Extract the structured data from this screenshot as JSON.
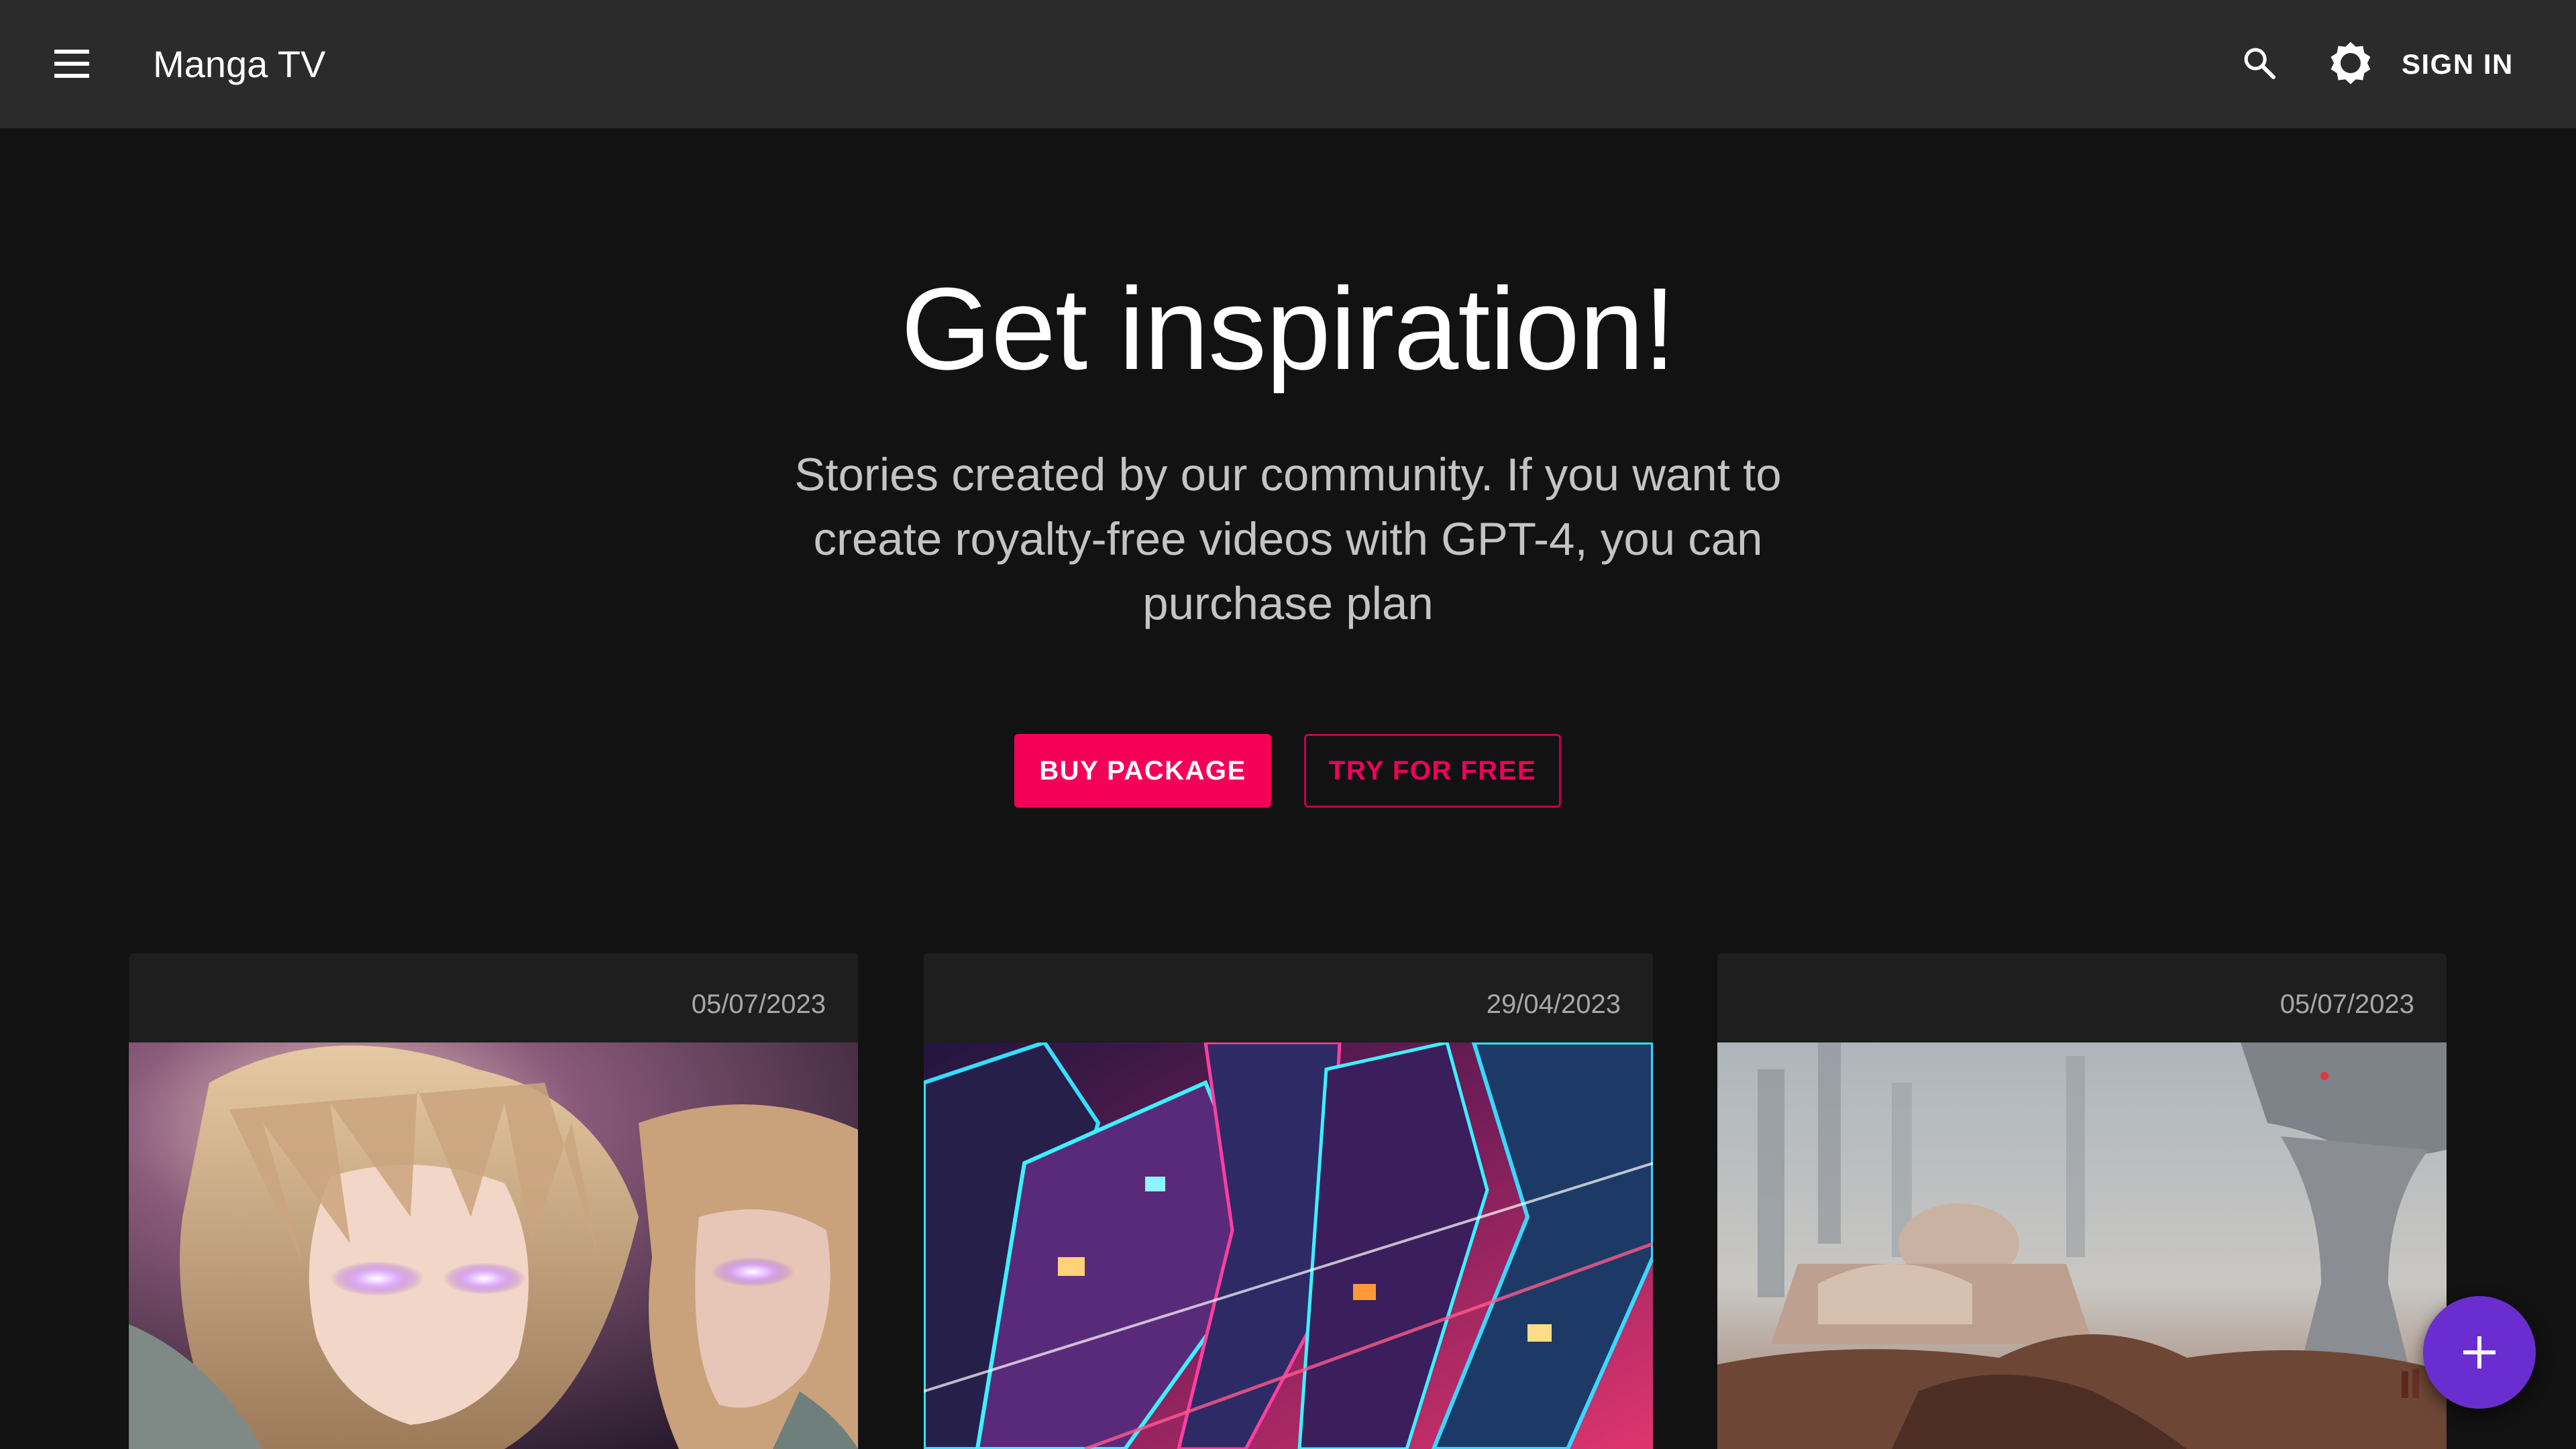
{
  "appbar": {
    "title": "Manga TV",
    "sign_in_label": "SIGN IN",
    "icons": [
      "menu-icon",
      "search-icon",
      "gear-icon"
    ]
  },
  "hero": {
    "title": "Get inspiration!",
    "subtitle": "Stories created by our community. If you want to create royalty-free videos with GPT-4, you can purchase plan",
    "buy_label": "BUY PACKAGE",
    "try_label": "TRY FOR FREE"
  },
  "cards": [
    {
      "date": "05/07/2023",
      "image": "anime-characters-glowing-eyes"
    },
    {
      "date": "29/04/2023",
      "image": "neon-cyberpunk-city"
    },
    {
      "date": "05/07/2023",
      "image": "desert-sci-fi-city"
    }
  ],
  "fab": {
    "icon": "plus-icon"
  },
  "colors": {
    "appbar_bg": "#2b2b2b",
    "page_bg": "#121212",
    "accent_pink": "#f50057",
    "fab_purple": "#6a2ed0",
    "card_bg": "#1e1e1e"
  }
}
